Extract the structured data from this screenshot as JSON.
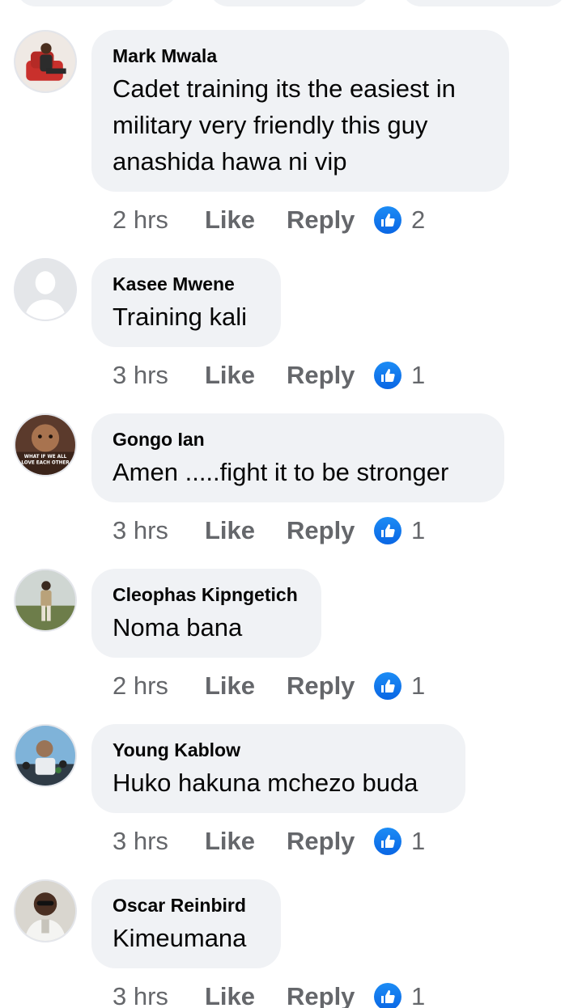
{
  "comments": [
    {
      "author": "Mark Mwala",
      "lines": [
        "Cadet training its the easiest in",
        "military  very friendly this guy",
        "anashida hawa ni vip"
      ],
      "time": "2 hrs",
      "like_label": "Like",
      "reply_label": "Reply",
      "reactions": "2"
    },
    {
      "author": "Kasee Mwene",
      "lines": [
        "Training kali"
      ],
      "time": "3 hrs",
      "like_label": "Like",
      "reply_label": "Reply",
      "reactions": "1"
    },
    {
      "author": "Gongo Ian",
      "lines": [
        "Amen .....fight it to be stronger"
      ],
      "time": "3 hrs",
      "like_label": "Like",
      "reply_label": "Reply",
      "reactions": "1",
      "avatar_caption": "WHAT IF WE ALL LOVE EACH OTHER"
    },
    {
      "author": "Cleophas Kipngetich",
      "lines": [
        "Noma bana"
      ],
      "time": "2 hrs",
      "like_label": "Like",
      "reply_label": "Reply",
      "reactions": "1"
    },
    {
      "author": "Young Kablow",
      "lines": [
        "Huko hakuna mchezo buda"
      ],
      "time": "3 hrs",
      "like_label": "Like",
      "reply_label": "Reply",
      "reactions": "1"
    },
    {
      "author": "Oscar Reinbird",
      "lines": [
        "Kimeumana"
      ],
      "time": "3 hrs",
      "like_label": "Like",
      "reply_label": "Reply",
      "reactions": "1"
    }
  ],
  "colors": {
    "bubble": "#f0f2f5",
    "secondary_text": "#65676b",
    "like_blue": "#1877f2"
  }
}
